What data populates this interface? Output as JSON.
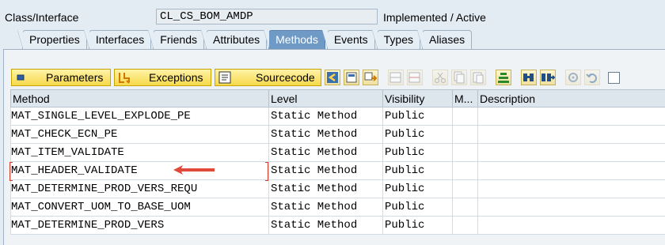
{
  "header": {
    "label": "Class/Interface",
    "class_name": "CL_CS_BOM_AMDP",
    "status": "Implemented / Active"
  },
  "tabs": [
    {
      "label": "Properties"
    },
    {
      "label": "Interfaces"
    },
    {
      "label": "Friends"
    },
    {
      "label": "Attributes"
    },
    {
      "label": "Methods",
      "active": true
    },
    {
      "label": "Events"
    },
    {
      "label": "Types"
    },
    {
      "label": "Aliases"
    }
  ],
  "toolbar": {
    "parameters_label": "Parameters",
    "exceptions_label": "Exceptions",
    "sourcecode_label": "Sourcecode"
  },
  "table": {
    "columns": [
      "Method",
      "Level",
      "Visibility",
      "M...",
      "Description"
    ],
    "rows": [
      {
        "method": "MAT_SINGLE_LEVEL_EXPLODE_PE",
        "level": "Static Method",
        "visibility": "Public",
        "m": "",
        "description": ""
      },
      {
        "method": "MAT_CHECK_ECN_PE",
        "level": "Static Method",
        "visibility": "Public",
        "m": "",
        "description": ""
      },
      {
        "method": "MAT_ITEM_VALIDATE",
        "level": "Static Method",
        "visibility": "Public",
        "m": "",
        "description": ""
      },
      {
        "method": "MAT_HEADER_VALIDATE",
        "level": "Static Method",
        "visibility": "Public",
        "m": "",
        "description": ""
      },
      {
        "method": "MAT_DETERMINE_PROD_VERS_REQU",
        "level": "Static Method",
        "visibility": "Public",
        "m": "",
        "description": ""
      },
      {
        "method": "MAT_CONVERT_UOM_TO_BASE_UOM",
        "level": "Static Method",
        "visibility": "Public",
        "m": "",
        "description": ""
      },
      {
        "method": "MAT_DETERMINE_PROD_VERS",
        "level": "Static Method",
        "visibility": "Public",
        "m": "",
        "description": ""
      }
    ]
  },
  "colors": {
    "active_tab": "#6f9ac5",
    "annotation_arrow": "#e04a3a"
  }
}
